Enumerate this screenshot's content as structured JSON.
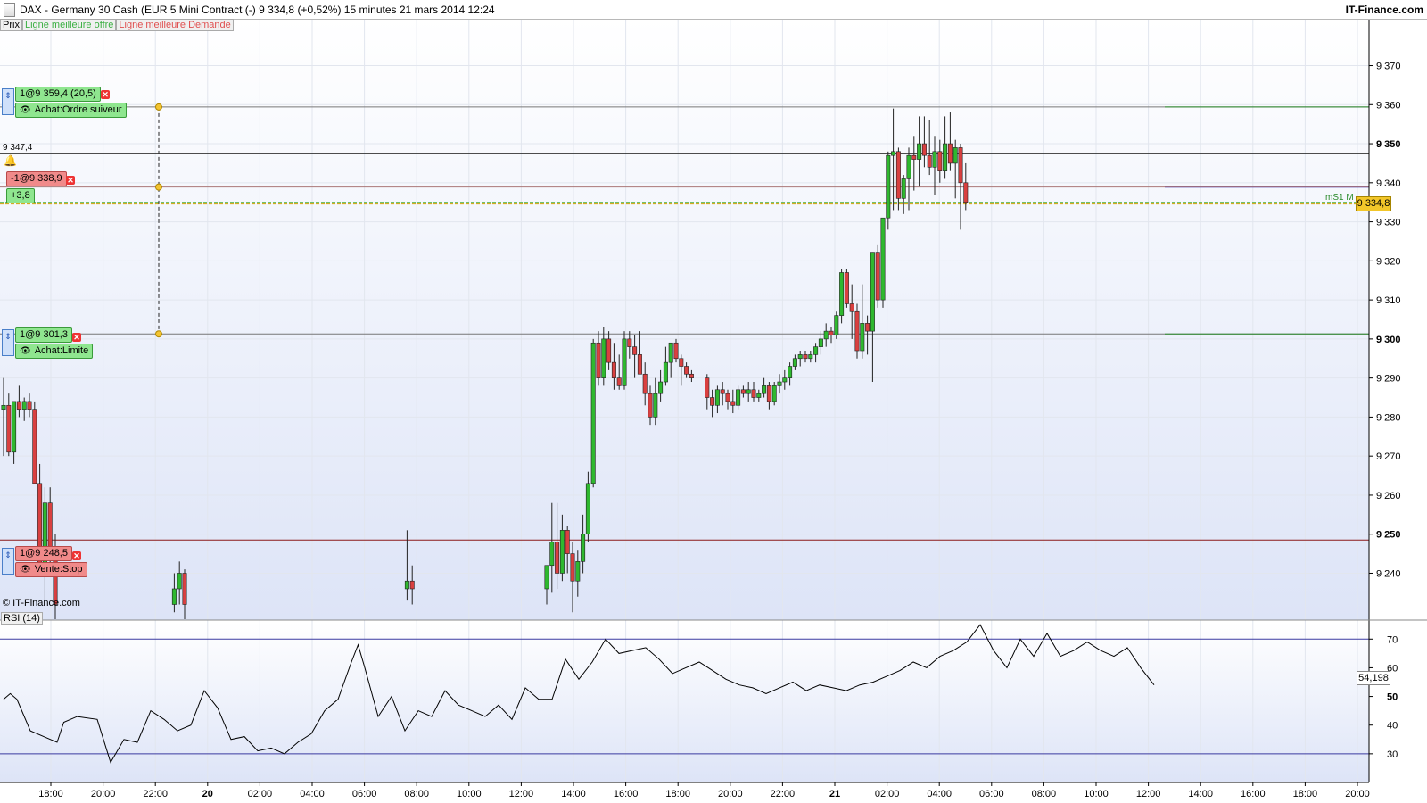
{
  "header": {
    "title": "DAX - Germany 30 Cash (EUR 5 Mini Contract (-)    9 334,8 (+0,52%)    15 minutes  21 mars 2014 12:24",
    "brand": "IT-Finance.com"
  },
  "legend": {
    "prix": "Prix",
    "offre": "Ligne meilleure offre",
    "demande": "Ligne meilleure Demande"
  },
  "orders": {
    "trailing": {
      "value": "1@9 359,4 (20,5)",
      "label": "Achat:Ordre suiveur"
    },
    "short": {
      "value": "-1@9 338,9",
      "pnl": "+3,8"
    },
    "limit": {
      "value": "1@9 301,3",
      "label": "Achat:Limite"
    },
    "stop": {
      "value": "1@9 248,5",
      "label": "Vente:Stop"
    }
  },
  "last_level_label": "9 347,4",
  "current_price": "9 334,8",
  "mS1_label": "mS1 M",
  "copyright": "© IT-Finance.com",
  "rsi": {
    "title": "RSI (14)",
    "current": "54,198"
  },
  "colors": {
    "up": "#2fb82f",
    "down": "#d94040",
    "bg_top": "#ffffff",
    "bg_bottom": "#dde4f7",
    "rsi_line": "#000000",
    "rsi_band": "#3a3aa0"
  },
  "chart_data": {
    "type": "candlestick",
    "timeframe": "15 minutes",
    "x_ticks": [
      "18:00",
      "20:00",
      "22:00",
      "20",
      "02:00",
      "04:00",
      "06:00",
      "08:00",
      "10:00",
      "12:00",
      "14:00",
      "16:00",
      "18:00",
      "20:00",
      "22:00",
      "21",
      "02:00",
      "04:00",
      "06:00",
      "08:00",
      "10:00",
      "12:00",
      "14:00",
      "16:00",
      "18:00",
      "20:00"
    ],
    "y_ticks": [
      9240,
      9250,
      9260,
      9270,
      9280,
      9290,
      9300,
      9310,
      9320,
      9330,
      9340,
      9350,
      9360,
      9370
    ],
    "ylim": [
      9228,
      9382
    ],
    "levels": [
      {
        "name": "Achat:Ordre suiveur",
        "price": 9359.4
      },
      {
        "name": "last",
        "price": 9347.4
      },
      {
        "name": "blue",
        "price": 9339.0
      },
      {
        "name": "-1@9 338,9",
        "price": 9338.9
      },
      {
        "name": "current",
        "price": 9334.8
      },
      {
        "name": "Achat:Limite",
        "price": 9301.3
      },
      {
        "name": "Vente:Stop",
        "price": 9248.5
      }
    ],
    "candles": [
      [
        0,
        9282,
        9290,
        9270,
        9283
      ],
      [
        1,
        9283,
        9286,
        9270,
        9271
      ],
      [
        2,
        9271,
        9275,
        9268,
        9284
      ],
      [
        3,
        9284,
        9288,
        9280,
        9282
      ],
      [
        4,
        9282,
        9285,
        9279,
        9284
      ],
      [
        5,
        9284,
        9286,
        9280,
        9282
      ],
      [
        6,
        9282,
        9284,
        9270,
        9263
      ],
      [
        7,
        9263,
        9268,
        9250,
        9240
      ],
      [
        8,
        9240,
        9262,
        9232,
        9258
      ],
      [
        9,
        9258,
        9262,
        9240,
        9245
      ],
      [
        10,
        9245,
        9250,
        9228,
        9232
      ],
      [
        33,
        9232,
        9240,
        9230,
        9236
      ],
      [
        34,
        9236,
        9243,
        9232,
        9240
      ],
      [
        35,
        9240,
        9241,
        9228,
        9232
      ],
      [
        78,
        9236,
        9251,
        9233,
        9238
      ],
      [
        79,
        9238,
        9242,
        9232,
        9236
      ],
      [
        105,
        9236,
        9240,
        9232,
        9242
      ],
      [
        106,
        9242,
        9258,
        9235,
        9248
      ],
      [
        107,
        9248,
        9258,
        9236,
        9240
      ],
      [
        108,
        9240,
        9255,
        9238,
        9251
      ],
      [
        109,
        9251,
        9252,
        9240,
        9245
      ],
      [
        110,
        9245,
        9248,
        9230,
        9238
      ],
      [
        111,
        9238,
        9246,
        9234,
        9243
      ],
      [
        112,
        9243,
        9255,
        9240,
        9250
      ],
      [
        113,
        9250,
        9266,
        9248,
        9263
      ],
      [
        114,
        9263,
        9300,
        9262,
        9299
      ],
      [
        115,
        9299,
        9302,
        9288,
        9290
      ],
      [
        116,
        9290,
        9303,
        9288,
        9300
      ],
      [
        117,
        9300,
        9302,
        9292,
        9294
      ],
      [
        118,
        9294,
        9299,
        9287,
        9290
      ],
      [
        119,
        9290,
        9296,
        9287,
        9288
      ],
      [
        120,
        9288,
        9302,
        9287,
        9300
      ],
      [
        121,
        9300,
        9302,
        9295,
        9298
      ],
      [
        122,
        9298,
        9301,
        9290,
        9296
      ],
      [
        123,
        9296,
        9302,
        9292,
        9291
      ],
      [
        124,
        9291,
        9294,
        9283,
        9286
      ],
      [
        125,
        9286,
        9288,
        9278,
        9280
      ],
      [
        126,
        9280,
        9290,
        9278,
        9286
      ],
      [
        127,
        9286,
        9292,
        9284,
        9289
      ],
      [
        128,
        9289,
        9298,
        9288,
        9294
      ],
      [
        129,
        9294,
        9298,
        9290,
        9299
      ],
      [
        130,
        9299,
        9300,
        9294,
        9295
      ],
      [
        131,
        9295,
        9296,
        9288,
        9293
      ],
      [
        132,
        9293,
        9294,
        9290,
        9291
      ],
      [
        133,
        9291,
        9292,
        9289,
        9290
      ],
      [
        136,
        9290,
        9291,
        9282,
        9285
      ],
      [
        137,
        9285,
        9287,
        9280,
        9283
      ],
      [
        138,
        9283,
        9288,
        9281,
        9287
      ],
      [
        139,
        9287,
        9289,
        9283,
        9286
      ],
      [
        140,
        9286,
        9287,
        9282,
        9284
      ],
      [
        141,
        9284,
        9287,
        9281,
        9283
      ],
      [
        142,
        9283,
        9288,
        9282,
        9287
      ],
      [
        143,
        9287,
        9288,
        9285,
        9286
      ],
      [
        144,
        9286,
        9289,
        9284,
        9287
      ],
      [
        145,
        9287,
        9289,
        9284,
        9285
      ],
      [
        146,
        9285,
        9287,
        9284,
        9286
      ],
      [
        147,
        9286,
        9290,
        9285,
        9288
      ],
      [
        148,
        9288,
        9289,
        9282,
        9284
      ],
      [
        149,
        9284,
        9289,
        9283,
        9288
      ],
      [
        150,
        9288,
        9291,
        9286,
        9289
      ],
      [
        151,
        9289,
        9292,
        9287,
        9290
      ],
      [
        152,
        9290,
        9294,
        9288,
        9293
      ],
      [
        153,
        9293,
        9296,
        9292,
        9295
      ],
      [
        154,
        9295,
        9297,
        9293,
        9296
      ],
      [
        155,
        9296,
        9297,
        9294,
        9295
      ],
      [
        156,
        9295,
        9297,
        9294,
        9296
      ],
      [
        157,
        9296,
        9299,
        9294,
        9298
      ],
      [
        158,
        9298,
        9302,
        9296,
        9300
      ],
      [
        159,
        9300,
        9304,
        9298,
        9302
      ],
      [
        160,
        9302,
        9303,
        9299,
        9301
      ],
      [
        161,
        9301,
        9307,
        9300,
        9306
      ],
      [
        162,
        9306,
        9318,
        9304,
        9317
      ],
      [
        163,
        9317,
        9318,
        9308,
        9309
      ],
      [
        164,
        9309,
        9314,
        9300,
        9307
      ],
      [
        165,
        9307,
        9309,
        9295,
        9297
      ],
      [
        166,
        9297,
        9314,
        9295,
        9304
      ],
      [
        167,
        9304,
        9306,
        9296,
        9302
      ],
      [
        168,
        9302,
        9322,
        9289,
        9322
      ],
      [
        169,
        9322,
        9324,
        9308,
        9310
      ],
      [
        170,
        9310,
        9331,
        9308,
        9331
      ],
      [
        171,
        9331,
        9348,
        9328,
        9347
      ],
      [
        172,
        9347,
        9359,
        9333,
        9348
      ],
      [
        173,
        9348,
        9349,
        9333,
        9336
      ],
      [
        174,
        9336,
        9342,
        9332,
        9341
      ],
      [
        175,
        9341,
        9349,
        9333,
        9347
      ],
      [
        176,
        9347,
        9352,
        9338,
        9346
      ],
      [
        177,
        9346,
        9357,
        9339,
        9350
      ],
      [
        178,
        9350,
        9357,
        9344,
        9347
      ],
      [
        179,
        9347,
        9356,
        9342,
        9344
      ],
      [
        180,
        9344,
        9352,
        9337,
        9348
      ],
      [
        181,
        9348,
        9351,
        9340,
        9343
      ],
      [
        182,
        9343,
        9357,
        9341,
        9350
      ],
      [
        183,
        9350,
        9358,
        9343,
        9345
      ],
      [
        184,
        9345,
        9351,
        9336,
        9349
      ],
      [
        185,
        9349,
        9350,
        9328,
        9340
      ],
      [
        186,
        9340,
        9345,
        9333,
        9335
      ]
    ],
    "rsi": {
      "y_ticks": [
        30,
        40,
        50,
        60,
        70
      ],
      "ylim": [
        20,
        76
      ],
      "bands": [
        30,
        70
      ],
      "values": [
        [
          0,
          49
        ],
        [
          5,
          51
        ],
        [
          10,
          49
        ],
        [
          20,
          38
        ],
        [
          30,
          36
        ],
        [
          40,
          34
        ],
        [
          45,
          41
        ],
        [
          55,
          43
        ],
        [
          70,
          42
        ],
        [
          80,
          27
        ],
        [
          90,
          35
        ],
        [
          100,
          34
        ],
        [
          110,
          45
        ],
        [
          120,
          42
        ],
        [
          130,
          38
        ],
        [
          140,
          40
        ],
        [
          150,
          52
        ],
        [
          160,
          46
        ],
        [
          170,
          35
        ],
        [
          180,
          36
        ],
        [
          190,
          31
        ],
        [
          200,
          32
        ],
        [
          210,
          30
        ],
        [
          220,
          34
        ],
        [
          230,
          37
        ],
        [
          240,
          45
        ],
        [
          250,
          49
        ],
        [
          260,
          62
        ],
        [
          265,
          68
        ],
        [
          270,
          60
        ],
        [
          280,
          43
        ],
        [
          290,
          50
        ],
        [
          300,
          38
        ],
        [
          310,
          45
        ],
        [
          320,
          43
        ],
        [
          330,
          52
        ],
        [
          340,
          47
        ],
        [
          350,
          45
        ],
        [
          360,
          43
        ],
        [
          370,
          47
        ],
        [
          380,
          42
        ],
        [
          390,
          53
        ],
        [
          400,
          49
        ],
        [
          410,
          49
        ],
        [
          420,
          63
        ],
        [
          430,
          56
        ],
        [
          440,
          62
        ],
        [
          450,
          70
        ],
        [
          460,
          65
        ],
        [
          470,
          66
        ],
        [
          480,
          67
        ],
        [
          490,
          63
        ],
        [
          500,
          58
        ],
        [
          510,
          60
        ],
        [
          520,
          62
        ],
        [
          530,
          59
        ],
        [
          540,
          56
        ],
        [
          550,
          54
        ],
        [
          560,
          53
        ],
        [
          570,
          51
        ],
        [
          580,
          53
        ],
        [
          590,
          55
        ],
        [
          600,
          52
        ],
        [
          610,
          54
        ],
        [
          620,
          53
        ],
        [
          630,
          52
        ],
        [
          640,
          54
        ],
        [
          650,
          55
        ],
        [
          660,
          57
        ],
        [
          670,
          59
        ],
        [
          680,
          62
        ],
        [
          690,
          60
        ],
        [
          700,
          64
        ],
        [
          710,
          66
        ],
        [
          720,
          69
        ],
        [
          730,
          75
        ],
        [
          740,
          66
        ],
        [
          750,
          60
        ],
        [
          760,
          70
        ],
        [
          770,
          64
        ],
        [
          780,
          72
        ],
        [
          790,
          64
        ],
        [
          800,
          66
        ],
        [
          810,
          69
        ],
        [
          820,
          66
        ],
        [
          830,
          64
        ],
        [
          840,
          67
        ],
        [
          850,
          60
        ],
        [
          860,
          54
        ]
      ]
    }
  }
}
